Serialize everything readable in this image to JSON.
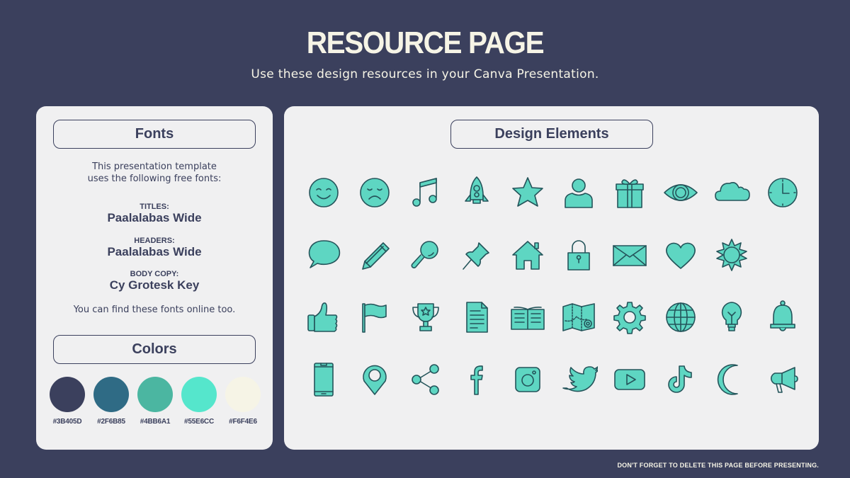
{
  "header": {
    "title": "RESOURCE PAGE",
    "subtitle": "Use these design resources in your Canva Presentation."
  },
  "fonts_panel": {
    "heading": "Fonts",
    "intro_line1": "This presentation template",
    "intro_line2": "uses the following free fonts:",
    "entries": [
      {
        "label": "TITLES:",
        "font": "Paalalabas Wide"
      },
      {
        "label": "HEADERS:",
        "font": "Paalalabas Wide"
      },
      {
        "label": "BODY COPY:",
        "font": "Cy Grotesk Key"
      }
    ],
    "outro": "You can find these fonts online too."
  },
  "colors_panel": {
    "heading": "Colors",
    "swatches": [
      {
        "hex": "#3B405D",
        "color": "#3b405d"
      },
      {
        "hex": "#2F6B85",
        "color": "#2f6b85"
      },
      {
        "hex": "#4BB6A1",
        "color": "#4bb6a1"
      },
      {
        "hex": "#55E6CC",
        "color": "#55e6cc"
      },
      {
        "hex": "#F6F4E6",
        "color": "#f6f4e6"
      }
    ]
  },
  "design_panel": {
    "heading": "Design Elements",
    "icon_fill": "#5ed6c2",
    "icon_stroke": "#24545a",
    "icons": [
      "smile-face",
      "sad-face",
      "music-note",
      "rocket",
      "star",
      "user",
      "gift",
      "eye",
      "cloud",
      "clock",
      "speech-bubble",
      "pencil",
      "magnifier",
      "pushpin",
      "house",
      "padlock",
      "envelope",
      "heart",
      "sun",
      "",
      "thumbs-up",
      "flag",
      "trophy",
      "document",
      "open-book",
      "map",
      "gear",
      "globe",
      "lightbulb",
      "bell",
      "smartphone",
      "location-pin",
      "share",
      "facebook",
      "instagram",
      "twitter",
      "youtube",
      "tiktok",
      "crescent-moon",
      "megaphone"
    ]
  },
  "footer": {
    "note": "DON'T FORGET TO DELETE THIS PAGE BEFORE PRESENTING."
  }
}
